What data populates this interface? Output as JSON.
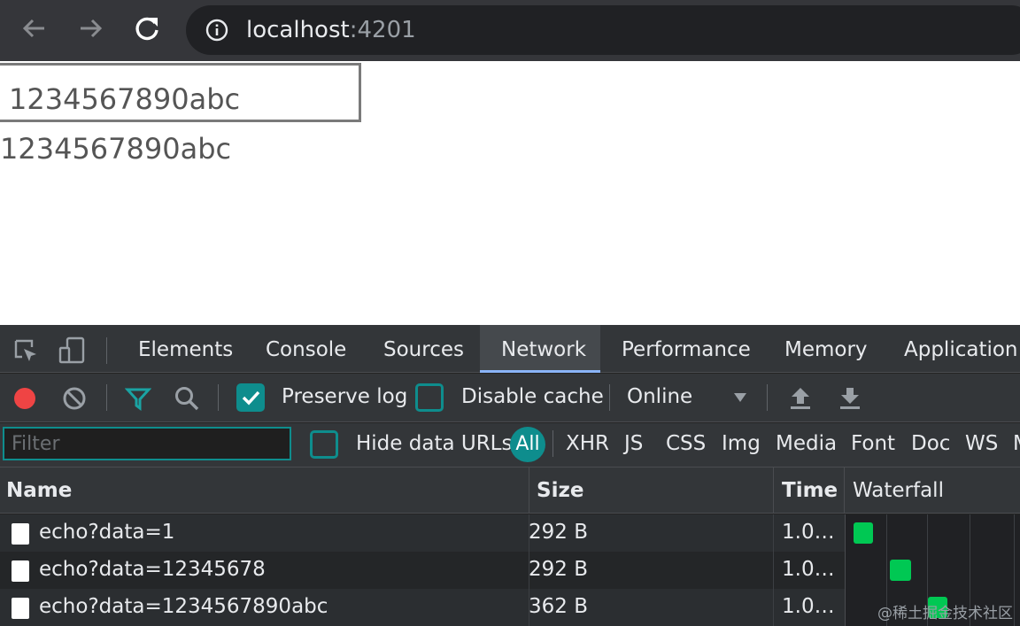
{
  "browser": {
    "url_host": "localhost",
    "url_port": ":4201"
  },
  "page": {
    "input_value": "1234567890abc",
    "echo_text": "1234567890abc"
  },
  "devtools": {
    "tabs": [
      {
        "label": "Elements"
      },
      {
        "label": "Console"
      },
      {
        "label": "Sources"
      },
      {
        "label": "Network"
      },
      {
        "label": "Performance"
      },
      {
        "label": "Memory"
      },
      {
        "label": "Application"
      }
    ],
    "active_tab": "Network",
    "toolbar": {
      "preserve_log": "Preserve log",
      "preserve_log_checked": true,
      "disable_cache": "Disable cache",
      "disable_cache_checked": false,
      "throttling": "Online"
    },
    "filter": {
      "placeholder": "Filter",
      "hide_data_urls": "Hide data URLs",
      "types": [
        "All",
        "XHR",
        "JS",
        "CSS",
        "Img",
        "Media",
        "Font",
        "Doc",
        "WS",
        "M"
      ]
    },
    "columns": {
      "name": "Name",
      "size": "Size",
      "time": "Time",
      "waterfall": "Waterfall"
    },
    "requests": [
      {
        "name": "echo?data=1",
        "size": "292 B",
        "time": "1.0…"
      },
      {
        "name": "echo?data=12345678",
        "size": "292 B",
        "time": "1.0…"
      },
      {
        "name": "echo?data=1234567890abc",
        "size": "362 B",
        "time": "1.0…"
      }
    ],
    "watermark": "@稀土掘金技术社区",
    "colors": {
      "accent": "#0e8d8d",
      "record": "#ef4444",
      "waterfall_bar": "#00c853"
    }
  }
}
